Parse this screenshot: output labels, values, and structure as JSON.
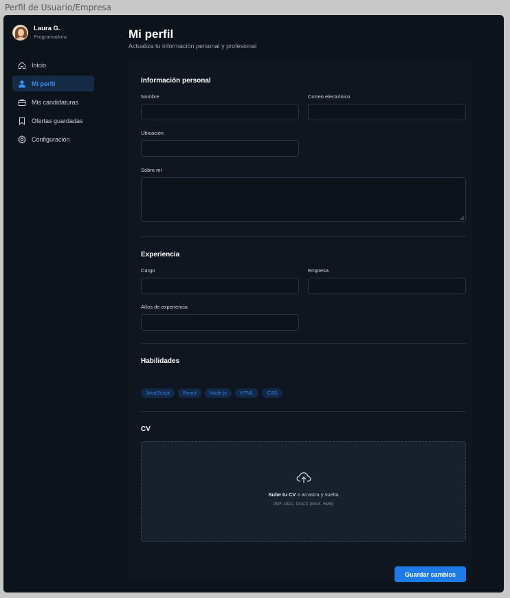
{
  "window": {
    "title": "Perfil de Usuario/Empresa"
  },
  "user": {
    "name": "Laura G.",
    "role": "Programadora"
  },
  "nav": {
    "items": [
      {
        "label": "Inicio",
        "icon": "home-icon",
        "active": false
      },
      {
        "label": "Mi perfil",
        "icon": "user-icon",
        "active": true
      },
      {
        "label": "Mis candidaturas",
        "icon": "briefcase-icon",
        "active": false
      },
      {
        "label": "Ofertas guardadas",
        "icon": "bookmark-icon",
        "active": false
      },
      {
        "label": "Configuración",
        "icon": "gear-icon",
        "active": false
      }
    ]
  },
  "page": {
    "title": "Mi perfil",
    "subtitle": "Actualiza tu información personal y profesional"
  },
  "personal": {
    "title": "Información personal",
    "name_label": "Nombre",
    "name_value": "",
    "email_label": "Correo electrónico",
    "email_value": "",
    "location_label": "Ubicación",
    "location_value": "",
    "about_label": "Sobre mí",
    "about_value": ""
  },
  "experience": {
    "title": "Experiencia",
    "role_label": "Cargo",
    "role_value": "",
    "company_label": "Empresa",
    "company_value": "",
    "years_label": "Años de experiencia",
    "years_value": ""
  },
  "skills": {
    "title": "Habilidades",
    "items": [
      "JavaScript",
      "React",
      "Node.js",
      "HTML",
      "CSS"
    ]
  },
  "cv": {
    "title": "CV",
    "upload_strong": "Sube tu CV",
    "upload_rest": " o arrastra y suelta",
    "formats": "PDF, DOC, DOCX (MAX. 5MB)"
  },
  "actions": {
    "save_label": "Guardar cambios"
  },
  "colors": {
    "accent": "#1e7ae6",
    "background": "#0d131b",
    "card": "#0f1620",
    "chip_bg": "#12294a",
    "chip_text": "#3d7fd6"
  }
}
